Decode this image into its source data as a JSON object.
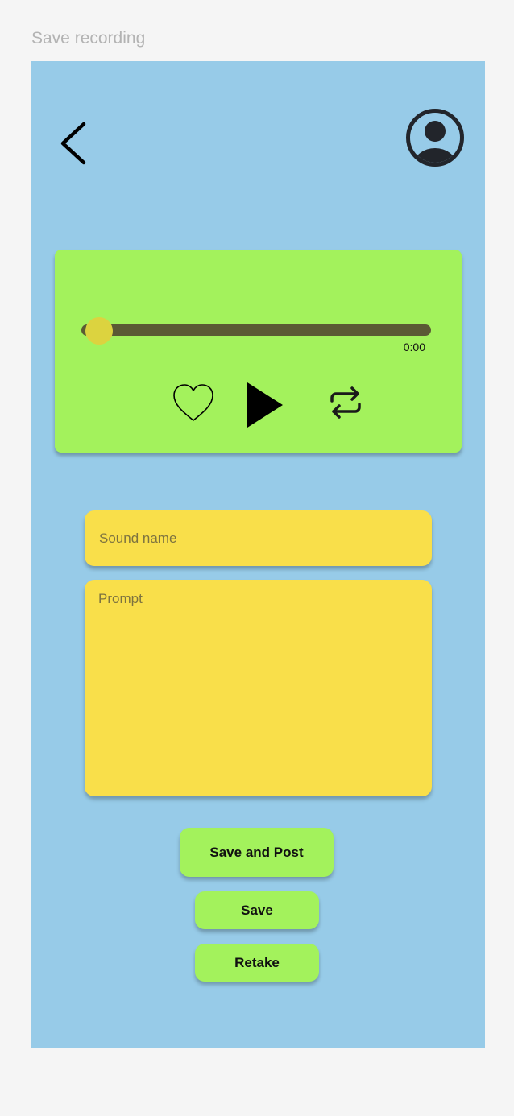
{
  "frame": {
    "title": "Save recording"
  },
  "header": {
    "back_icon": "chevron-left-icon",
    "profile_icon": "user-circle-icon"
  },
  "player": {
    "time": "0:00",
    "progress": 0.05,
    "controls": [
      "heart-icon",
      "play-icon",
      "repeat-icon"
    ]
  },
  "form": {
    "sound_name_placeholder": "Sound name",
    "sound_name_value": "",
    "prompt_placeholder": "Prompt",
    "prompt_value": ""
  },
  "actions": {
    "save_and_post": "Save and Post",
    "save": "Save",
    "retake": "Retake"
  },
  "colors": {
    "screen_bg": "#97cbe8",
    "accent_green": "#a3f25c",
    "field_yellow": "#f9df4a",
    "track": "#5a5a34",
    "thumb": "#dcd33f"
  }
}
